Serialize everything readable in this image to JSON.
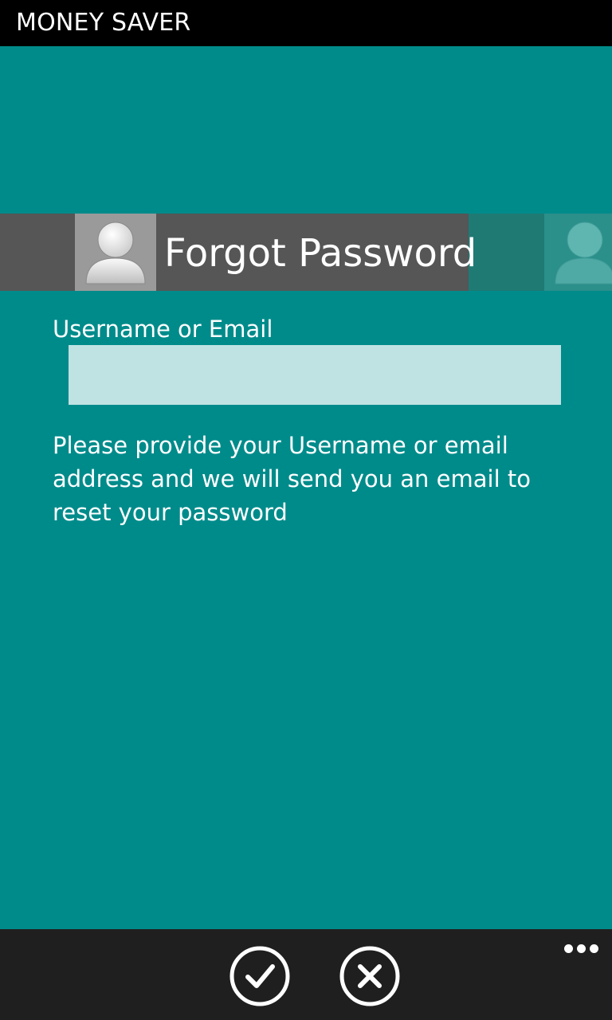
{
  "app": {
    "title": "MONEY SAVER"
  },
  "header": {
    "title": "Forgot Password",
    "icon": "user-icon",
    "secondary_icon": "user-icon"
  },
  "form": {
    "field_label": "Username or Email",
    "field_value": "",
    "field_placeholder": "",
    "help_text": "Please provide your Username or email address and we will send you an email to reset your password"
  },
  "app_bar": {
    "buttons": [
      {
        "name": "confirm",
        "icon": "check-icon"
      },
      {
        "name": "cancel",
        "icon": "close-icon"
      }
    ],
    "more_icon": "ellipsis-icon"
  },
  "colors": {
    "background": "#008b8b",
    "title_bar": "#000000",
    "header_band": "#565656",
    "input_background": "#bfe2e3",
    "app_bar": "#1f1f1f",
    "text": "#ffffff"
  }
}
